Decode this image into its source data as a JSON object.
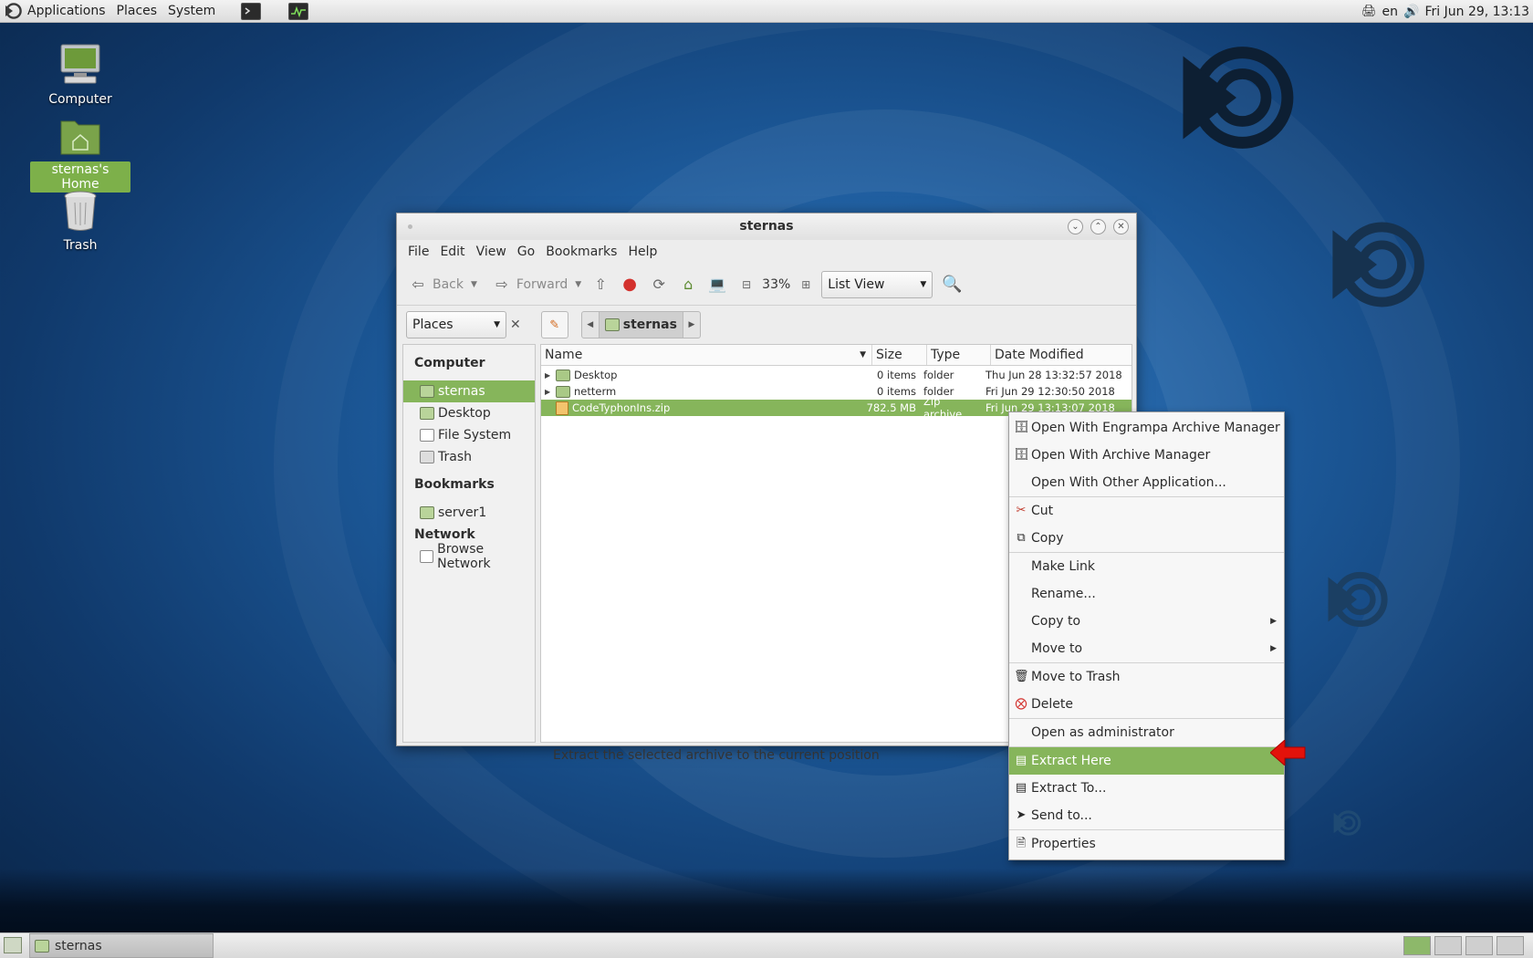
{
  "top_panel": {
    "menus": [
      "Applications",
      "Places",
      "System"
    ],
    "keyboard_layout": "en",
    "clock": "Fri Jun 29, 13:13"
  },
  "desktop": {
    "icons": [
      {
        "label": "Computer",
        "icon": "computer-icon"
      },
      {
        "label": "sternas's Home",
        "icon": "home-folder-icon",
        "selected": true
      },
      {
        "label": "Trash",
        "icon": "trash-icon"
      }
    ]
  },
  "window": {
    "title": "sternas",
    "menu": [
      "File",
      "Edit",
      "View",
      "Go",
      "Bookmarks",
      "Help"
    ],
    "toolbar": {
      "back_label": "Back",
      "forward_label": "Forward",
      "zoom": "33%",
      "view_mode": "List View"
    },
    "side_pane_select": "Places",
    "path_crumb": "sternas",
    "sidebar": {
      "computer_heading": "Computer",
      "computer_items": [
        "sternas",
        "Desktop",
        "File System",
        "Trash"
      ],
      "bookmarks_heading": "Bookmarks",
      "bookmark_items": [
        "server1"
      ],
      "network_heading": "Network",
      "network_items": [
        "Browse Network"
      ]
    },
    "columns": [
      "Name",
      "Size",
      "Type",
      "Date Modified"
    ],
    "files": [
      {
        "name": "Desktop",
        "size": "0 items",
        "type": "folder",
        "date": "Thu Jun 28 13:32:57 2018"
      },
      {
        "name": "netterm",
        "size": "0 items",
        "type": "folder",
        "date": "Fri Jun 29 12:30:50 2018"
      },
      {
        "name": "CodeTyphonIns.zip",
        "size": "782.5 MB",
        "type": "Zip archive",
        "date": "Fri Jun 29 13:13:07 2018"
      }
    ],
    "status": "Extract the selected archive to the current position"
  },
  "context_menu": {
    "groups": [
      [
        "Open With Engrampa Archive Manager",
        "Open With Archive Manager",
        "Open With Other Application..."
      ],
      [
        "Cut",
        "Copy"
      ],
      [
        "Make Link",
        "Rename...",
        "Copy to",
        "Move to"
      ],
      [
        "Move to Trash",
        "Delete"
      ],
      [
        "Open as administrator"
      ],
      [
        "Extract Here",
        "Extract To...",
        "Send to..."
      ],
      [
        "Properties"
      ]
    ],
    "highlighted": "Extract Here"
  },
  "taskbar": {
    "task_label": "sternas"
  },
  "colors": {
    "selection": "#86b55b",
    "annotation_arrow": "#e3120b"
  }
}
